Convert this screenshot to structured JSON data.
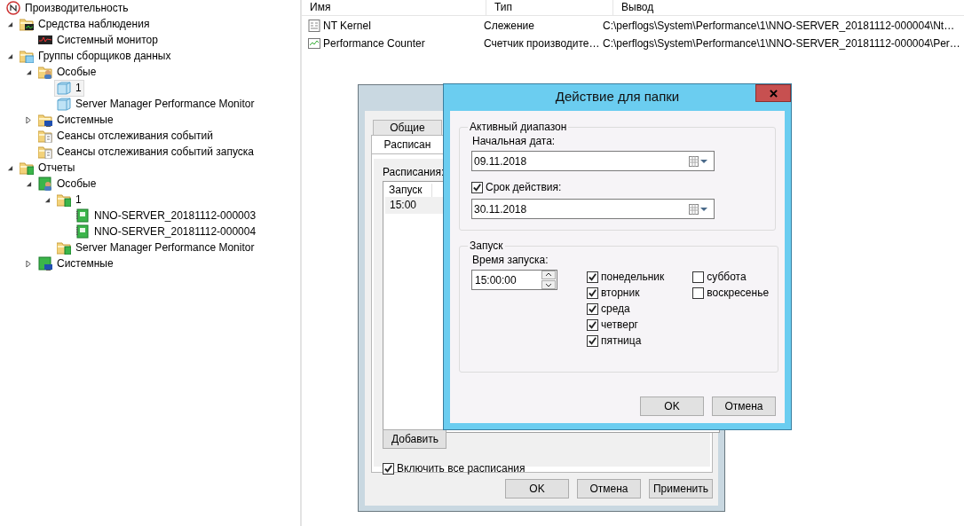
{
  "tree": [
    {
      "label": "Производительность",
      "kind": "perf",
      "selected": false,
      "children": [
        {
          "label": "Средства наблюдения",
          "kind": "folder-monitor",
          "expanded": true,
          "selected": false,
          "children": [
            {
              "label": "Системный монитор",
              "kind": "monitor",
              "selected": false
            }
          ]
        },
        {
          "label": "Группы сборщиков данных",
          "kind": "folder-collector",
          "expanded": true,
          "selected": false,
          "children": [
            {
              "label": "Особые",
              "kind": "folder-user",
              "expanded": true,
              "selected": false,
              "children": [
                {
                  "label": "1",
                  "kind": "collector",
                  "selected": true
                },
                {
                  "label": "Server Manager Performance Monitor",
                  "kind": "collector",
                  "selected": false
                }
              ]
            },
            {
              "label": "Системные",
              "kind": "folder-system",
              "expanded": false,
              "selected": false
            },
            {
              "label": "Сеансы отслеживания событий",
              "kind": "folder-trace",
              "selected": false
            },
            {
              "label": "Сеансы отслеживания событий запуска",
              "kind": "folder-trace",
              "selected": false
            }
          ]
        },
        {
          "label": "Отчеты",
          "kind": "folder-report",
          "expanded": true,
          "selected": false,
          "children": [
            {
              "label": "Особые",
              "kind": "report-user",
              "expanded": true,
              "selected": false,
              "children": [
                {
                  "label": "1",
                  "kind": "folder-report",
                  "expanded": true,
                  "selected": false,
                  "children": [
                    {
                      "label": "NNO-SERVER_20181112-000003",
                      "kind": "report",
                      "selected": false
                    },
                    {
                      "label": "NNO-SERVER_20181112-000004",
                      "kind": "report",
                      "selected": false
                    }
                  ]
                },
                {
                  "label": "Server Manager Performance Monitor",
                  "kind": "folder-report",
                  "selected": false
                }
              ]
            },
            {
              "label": "Системные",
              "kind": "report-system",
              "expanded": false,
              "selected": false
            }
          ]
        }
      ]
    }
  ],
  "list": {
    "columns": [
      "Имя",
      "Тип",
      "Вывод"
    ],
    "rows": [
      {
        "kind": "trace",
        "name": "NT Kernel",
        "type": "Слежение",
        "output": "C:\\perflogs\\System\\Performance\\1\\NNO-SERVER_20181112-000004\\Nt…"
      },
      {
        "kind": "counter",
        "name": "Performance Counter",
        "type": "Счетчик производите…",
        "output": "C:\\perflogs\\System\\Performance\\1\\NNO-SERVER_20181112-000004\\Per…"
      }
    ]
  },
  "properties_dialog": {
    "tabs": [
      {
        "label": "Общие",
        "selected": false
      },
      {
        "label": "Расписан",
        "selected": true
      }
    ],
    "schedules_label": "Расписания:",
    "schedule_columns": [
      "Запуск"
    ],
    "schedule_rows": [
      [
        "15:00"
      ]
    ],
    "add_button": "Добавить",
    "enable_all": {
      "label": "Включить все расписания",
      "checked": true
    },
    "buttons": [
      "OK",
      "Отмена",
      "Применить"
    ]
  },
  "folder_action_dialog": {
    "title": "Действие для папки",
    "active_range": {
      "title": "Активный диапазон",
      "start_label": "Начальная дата:",
      "start_date": "09.11.2018",
      "expiration": {
        "label": "Срок действия:",
        "checked": true
      },
      "end_date": "30.11.2018"
    },
    "launch": {
      "title": "Запуск",
      "time_label": "Время запуска:",
      "time": "15:00:00",
      "days": [
        {
          "label": "понедельник",
          "checked": true
        },
        {
          "label": "вторник",
          "checked": true
        },
        {
          "label": "среда",
          "checked": true
        },
        {
          "label": "четверг",
          "checked": true
        },
        {
          "label": "пятница",
          "checked": true
        },
        {
          "label": "суббота",
          "checked": false
        },
        {
          "label": "воскресенье",
          "checked": false
        }
      ]
    },
    "buttons": [
      "OK",
      "Отмена"
    ]
  }
}
